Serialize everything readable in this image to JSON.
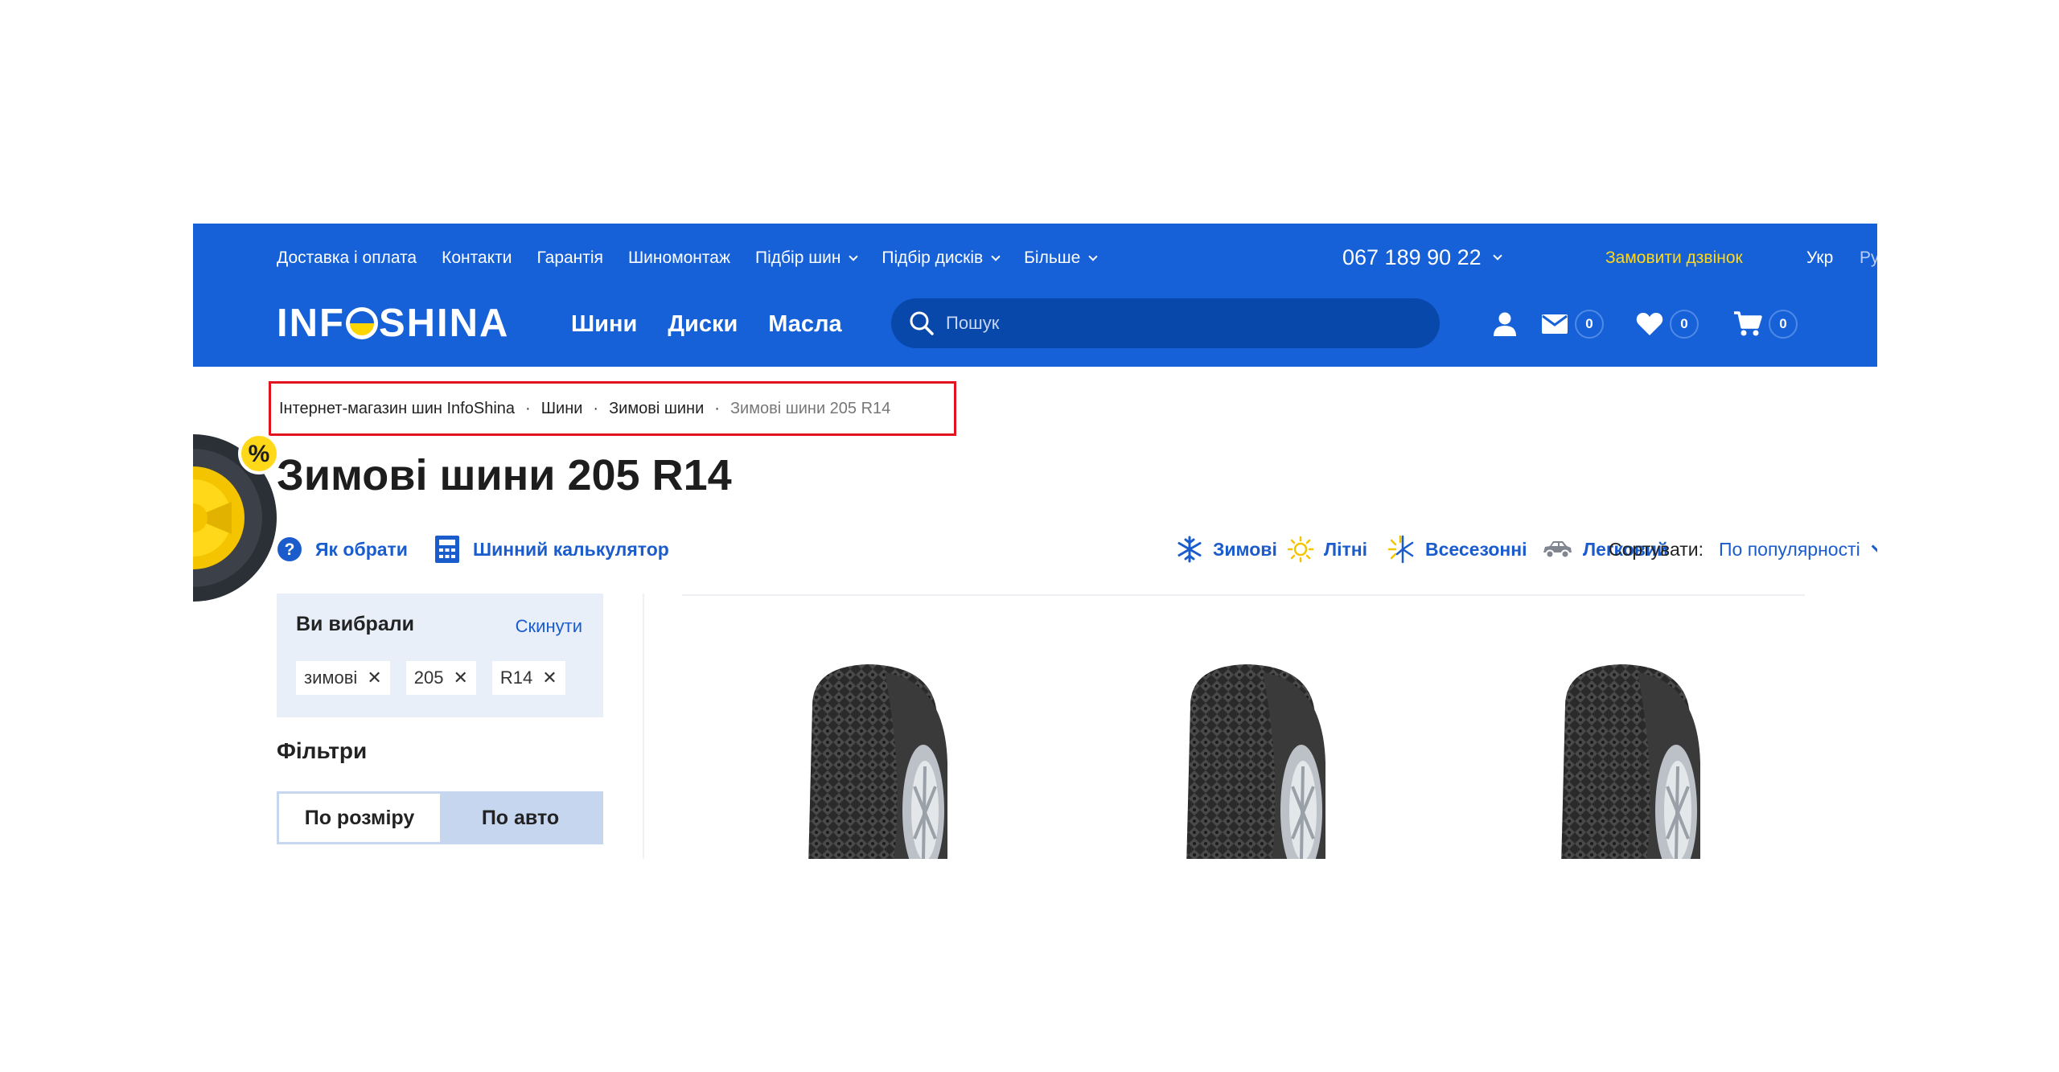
{
  "header": {
    "top_nav": [
      {
        "label": "Доставка і оплата",
        "dropdown": false
      },
      {
        "label": "Контакти",
        "dropdown": false
      },
      {
        "label": "Гарантія",
        "dropdown": false
      },
      {
        "label": "Шиномонтаж",
        "dropdown": false
      },
      {
        "label": "Підбір шин",
        "dropdown": true
      },
      {
        "label": "Підбір дисків",
        "dropdown": true
      },
      {
        "label": "Більше",
        "dropdown": true
      }
    ],
    "phone": "067 189 90 22",
    "callback": "Замовити дзвінок",
    "languages": [
      "Укр",
      "Рус"
    ],
    "logo": {
      "left": "INF",
      "right": "SHINA"
    },
    "main_nav": [
      "Шини",
      "Диски",
      "Масла"
    ],
    "search_placeholder": "Пошук",
    "counters": {
      "messages": "0",
      "favorites": "0",
      "cart": "0"
    }
  },
  "breadcrumb": {
    "items": [
      "Інтернет-магазин шин InfoShina",
      "Шини",
      "Зимові шини"
    ],
    "current": "Зимові шини 205 R14"
  },
  "page_title": "Зимові шини 205 R14",
  "tools": {
    "how_to_choose": "Як обрати",
    "calculator": "Шинний калькулятор",
    "seasons": [
      "Зимові",
      "Літні",
      "Всесезонні"
    ],
    "vehicle": "Легковий",
    "sort_label": "Сортувати:",
    "sort_value": "По популярності"
  },
  "sidebar": {
    "selected_title": "Ви вибрали",
    "reset": "Скинути",
    "chips": [
      "зимові",
      "205",
      "R14"
    ],
    "filters_title": "Фільтри",
    "toggle": {
      "by_size": "По розміру",
      "by_car": "По авто"
    }
  },
  "colors": {
    "header_bg": "#1660d8",
    "accent_yellow": "#ffd81a",
    "link_blue": "#1a5ccc",
    "highlight_red": "#e0131f"
  }
}
